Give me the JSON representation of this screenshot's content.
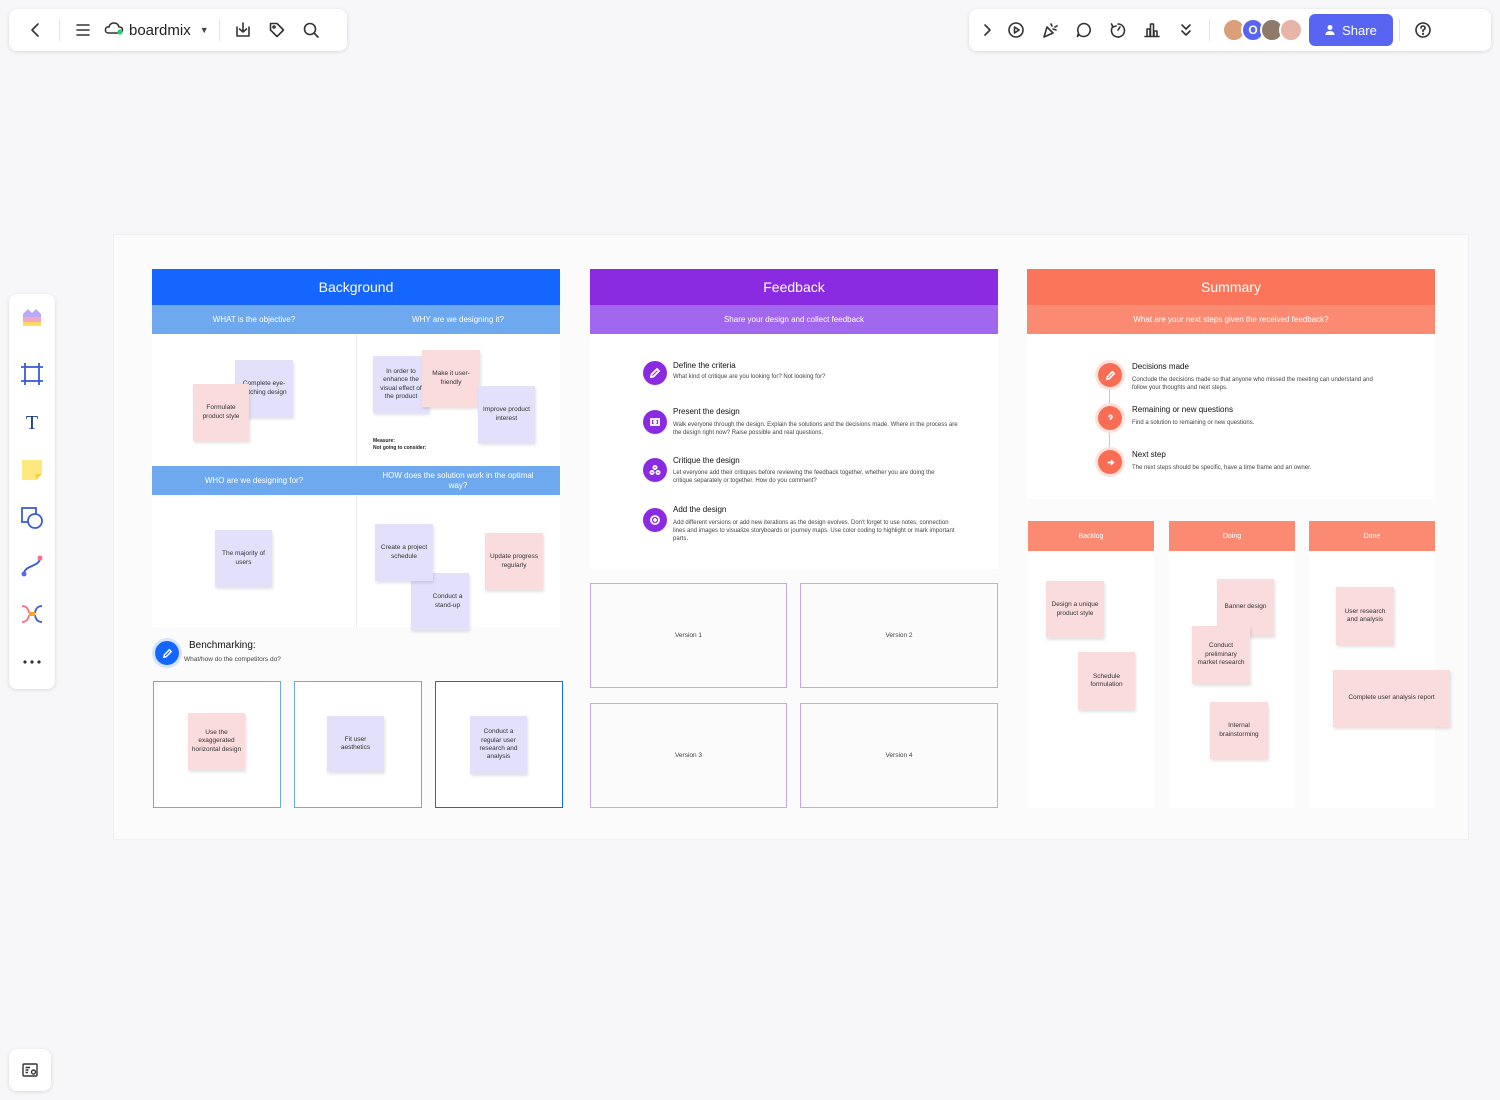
{
  "app": {
    "name": "boardmix",
    "share_label": "Share"
  },
  "avatars": [
    {
      "color": "#d9a07a",
      "initial": ""
    },
    {
      "color": "#5865f2",
      "initial": "O"
    },
    {
      "color": "#8d7a6a",
      "initial": ""
    },
    {
      "color": "#e8b4a8",
      "initial": ""
    }
  ],
  "colors": {
    "blue": "#1565ff",
    "blue_light": "#6ea8ee",
    "purple": "#8a2be2",
    "purple_light": "#a267ef",
    "coral": "#fa7559",
    "coral_light": "#fa8a72",
    "accent": "#5865f2"
  },
  "background": {
    "title": "Background",
    "q1": "WHAT is the objective?",
    "q2": "WHY are we designing it?",
    "q3": "WHO are we designing for?",
    "q4": "HOW does the solution work in the optimal way?",
    "stickies": {
      "complete": "Complete eye-catching design",
      "formulate": "Formulate product style",
      "in_order": "In order to enhance the visual effect of the product",
      "make_it": "Make it user-friendly",
      "improve": "Improve product interest",
      "majority": "The majority of users",
      "create": "Create a project schedule",
      "conduct": "Conduct a stand-up",
      "update": "Update progress regularly"
    },
    "measure_label": "Measure:",
    "not_going": "Not going to consider:"
  },
  "benchmarking": {
    "title": "Benchmarking:",
    "subtitle": "What/how do the competitors do?",
    "items": [
      "Use the exaggerated horizontal design",
      "Fit user aesthetics",
      "Conduct a regular user research and analysis"
    ]
  },
  "feedback": {
    "title": "Feedback",
    "subtitle": "Share your design and collect feedback",
    "items": [
      {
        "title": "Define the criteria",
        "desc": "What kind of critique are you looking for? Not looking for?"
      },
      {
        "title": "Present the design",
        "desc": "Walk everyone through the design. Explain the solutions and the decisions made. Where in the process are the design right now? Raise possible and real questions."
      },
      {
        "title": "Critique the design",
        "desc": "Let everyone add their critiques before reviewing the feedback together, whether you are doing the critique separately or together. How do you comment?"
      },
      {
        "title": "Add the design",
        "desc": "Add different versions or add new iterations as the design evolves. Don't forget to use notes, connection lines and images to visualize storyboards or journey maps. Use color coding to highlight or mark important parts."
      }
    ],
    "versions": [
      "Version 1",
      "Version 2",
      "Version 3",
      "Version 4"
    ]
  },
  "summary": {
    "title": "Summary",
    "subtitle": "What are your next steps given the received feedback?",
    "items": [
      {
        "title": "Decisions made",
        "desc": "Conclude the decisions made so that anyone who missed the meeting can understand and follow your thoughts and next steps."
      },
      {
        "title": "Remaining or new questions",
        "desc": "Find a solution to remaining or new questions."
      },
      {
        "title": "Next step",
        "desc": "The next steps should be specific, have a time frame and an owner."
      }
    ]
  },
  "kanban": {
    "columns": [
      "Backlog",
      "Doing",
      "Done"
    ],
    "backlog": [
      "Design a unique product style",
      "Schedule formulation"
    ],
    "doing": [
      "Banner design",
      "Conduct preliminary market research",
      "Internal brainstorming"
    ],
    "done": [
      "User research and analysis",
      "Complete user analysis report"
    ]
  }
}
